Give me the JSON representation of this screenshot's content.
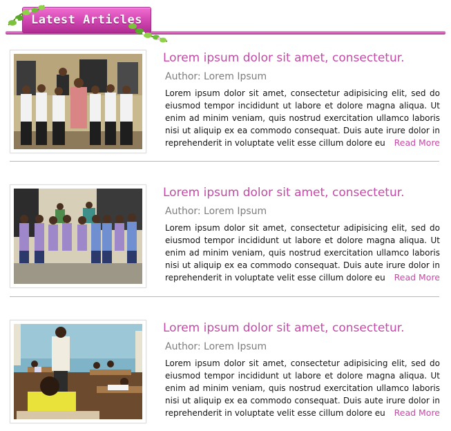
{
  "header": {
    "title": "Latest Articles"
  },
  "colors": {
    "accent": "#c34aa6",
    "banner": "#d64bb7",
    "divider": "#d9a3cc",
    "author": "#7d7d7d"
  },
  "articles": [
    {
      "image_icon": "group-photo-students-uniforms",
      "title": "Lorem ipsum dolor sit amet, consectetur.",
      "author": "Author: Lorem Ipsum",
      "excerpt": "Lorem ipsum dolor sit amet, consectetur adipisicing elit, sed do eiusmod tempor incididunt ut labore et dolore magna aliqua. Ut enim ad minim veniam, quis nostrud exercitation ullamco laboris nisi ut aliquip ex ea commodo consequat. Duis aute irure dolor in reprehenderit in voluptate velit esse cillum dolore eu",
      "read_more": "Read More"
    },
    {
      "image_icon": "group-photo-children-purple-uniforms",
      "title": "Lorem ipsum dolor sit amet, consectetur.",
      "author": "Author: Lorem Ipsum",
      "excerpt": "Lorem ipsum dolor sit amet, consectetur adipisicing elit, sed do eiusmod tempor incididunt ut labore et dolore magna aliqua. Ut enim ad minim veniam, quis nostrud exercitation ullamco laboris nisi ut aliquip ex ea commodo consequat. Duis aute irure dolor in reprehenderit in voluptate velit esse cillum dolore eu",
      "read_more": "Read More"
    },
    {
      "image_icon": "classroom-photo-students-writing",
      "title": "Lorem ipsum dolor sit amet, consectetur.",
      "author": "Author: Lorem Ipsum",
      "excerpt": "Lorem ipsum dolor sit amet, consectetur adipisicing elit, sed do eiusmod tempor incididunt ut labore et dolore magna aliqua. Ut enim ad minim veniam, quis nostrud exercitation ullamco laboris nisi ut aliquip ex ea commodo consequat. Duis aute irure dolor in reprehenderit in voluptate velit esse cillum dolore eu",
      "read_more": "Read More"
    }
  ]
}
